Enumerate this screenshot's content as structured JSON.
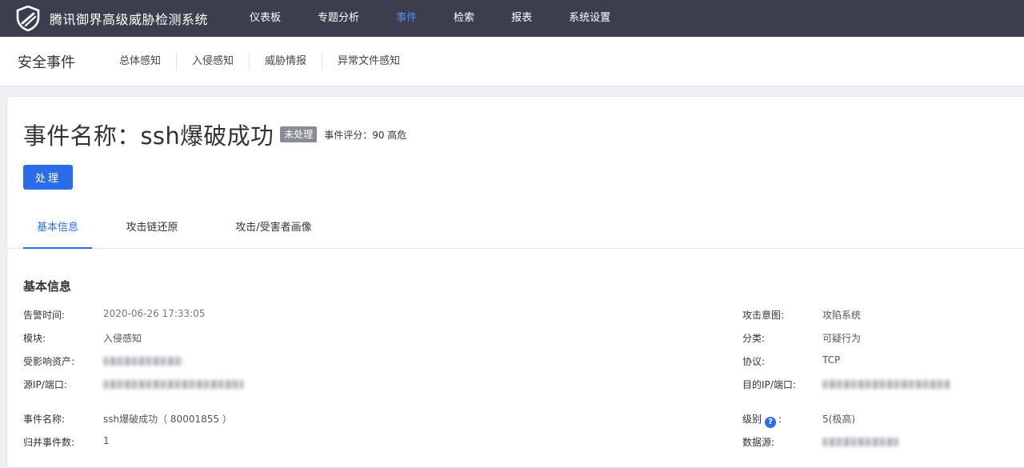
{
  "app": {
    "title": "腾讯御界高级威胁检测系统",
    "nav": [
      "仪表板",
      "专题分析",
      "事件",
      "检索",
      "报表",
      "系统设置"
    ],
    "active_nav": "事件"
  },
  "subheader": {
    "title": "安全事件",
    "items": [
      "总体感知",
      "入侵感知",
      "威胁情报",
      "异常文件感知"
    ]
  },
  "event": {
    "title": "事件名称：ssh爆破成功",
    "status": "未处理",
    "score": "事件评分：90 高危",
    "action_label": "处理"
  },
  "tabs": [
    "基本信息",
    "攻击链还原",
    "攻击/受害者画像"
  ],
  "basic_info": {
    "heading": "基本信息",
    "left": [
      {
        "label": "告警时间:",
        "value": "2020-06-26 17:33:05"
      },
      {
        "label": "模块:",
        "value": "入侵感知"
      },
      {
        "label": "受影响资产:",
        "value": ""
      },
      {
        "label": "源IP/端口:",
        "value": ""
      },
      {
        "label": "事件名称:",
        "value": "ssh爆破成功（ 80001855 ）"
      },
      {
        "label": "归并事件数:",
        "value": "1"
      }
    ],
    "right": [
      {
        "label": "攻击意图:",
        "value": "攻陷系统"
      },
      {
        "label": "分类:",
        "value": "可疑行为"
      },
      {
        "label": "协议:",
        "value": "TCP"
      },
      {
        "label": "目的IP/端口:",
        "value": ""
      },
      {
        "label": "级别",
        "suffix": ":",
        "value": "5(极高)"
      },
      {
        "label": "数据源:",
        "value": ""
      }
    ]
  },
  "colors": {
    "topbar": "#3c3e4d",
    "accent": "#2b6de8",
    "active_nav": "#4f8ef7",
    "badge": "#8a8c94"
  }
}
